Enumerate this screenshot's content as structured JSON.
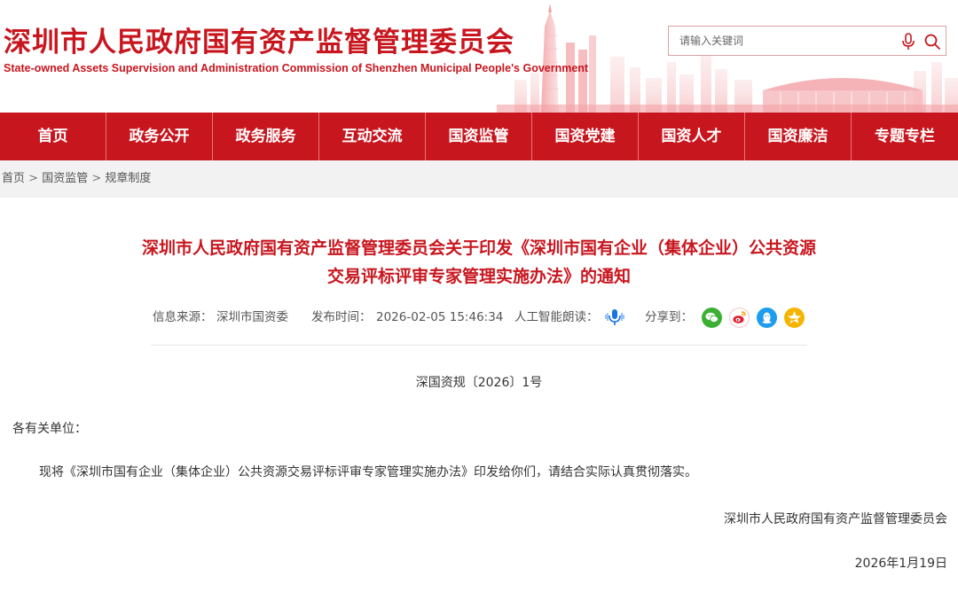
{
  "header": {
    "title": "深圳市人民政府国有资产监督管理委员会",
    "subtitle": "State-owned Assets Supervision and Administration Commission of Shenzhen Municipal People's Government"
  },
  "search": {
    "placeholder": "请输入关键词",
    "mic_icon": "microphone-icon",
    "search_icon": "search-icon"
  },
  "nav": {
    "items": [
      {
        "label": "首页"
      },
      {
        "label": "政务公开"
      },
      {
        "label": "政务服务"
      },
      {
        "label": "互动交流"
      },
      {
        "label": "国资监管"
      },
      {
        "label": "国资党建"
      },
      {
        "label": "国资人才"
      },
      {
        "label": "国资廉洁"
      },
      {
        "label": "专题专栏"
      }
    ]
  },
  "breadcrumb": {
    "items": [
      "首页",
      "国资监管",
      "规章制度"
    ],
    "separator": ">"
  },
  "article": {
    "title_line1": "深圳市人民政府国有资产监督管理委员会关于印发《深圳市国有企业（集体企业）公共资源",
    "title_line2": "交易评标评审专家管理实施办法》的通知",
    "meta": {
      "source_label": "信息来源：",
      "source_value": "深圳市国资委",
      "time_label": "发布时间：",
      "time_value": "2026-02-05 15:46:34",
      "ai_read_label": "人工智能朗读：",
      "share_label": "分享到："
    },
    "share_icons": [
      {
        "name": "wechat-icon",
        "color": "#3cb034"
      },
      {
        "name": "weibo-icon",
        "color": "#e6162d"
      },
      {
        "name": "qq-icon",
        "color": "#1e9cf0"
      },
      {
        "name": "qzone-icon",
        "color": "#f5b400"
      }
    ],
    "doc_number": "深国资规〔2026〕1号",
    "addressee": "各有关单位：",
    "body": "现将《深圳市国有企业（集体企业）公共资源交易评标评审专家管理实施办法》印发给你们，请结合实际认真贯彻落实。",
    "signature": "深圳市人民政府国有资产监督管理委员会",
    "date": "2026年1月19日"
  },
  "colors": {
    "brand_red": "#c8161e",
    "breadcrumb_bg": "#f2f2f2"
  }
}
